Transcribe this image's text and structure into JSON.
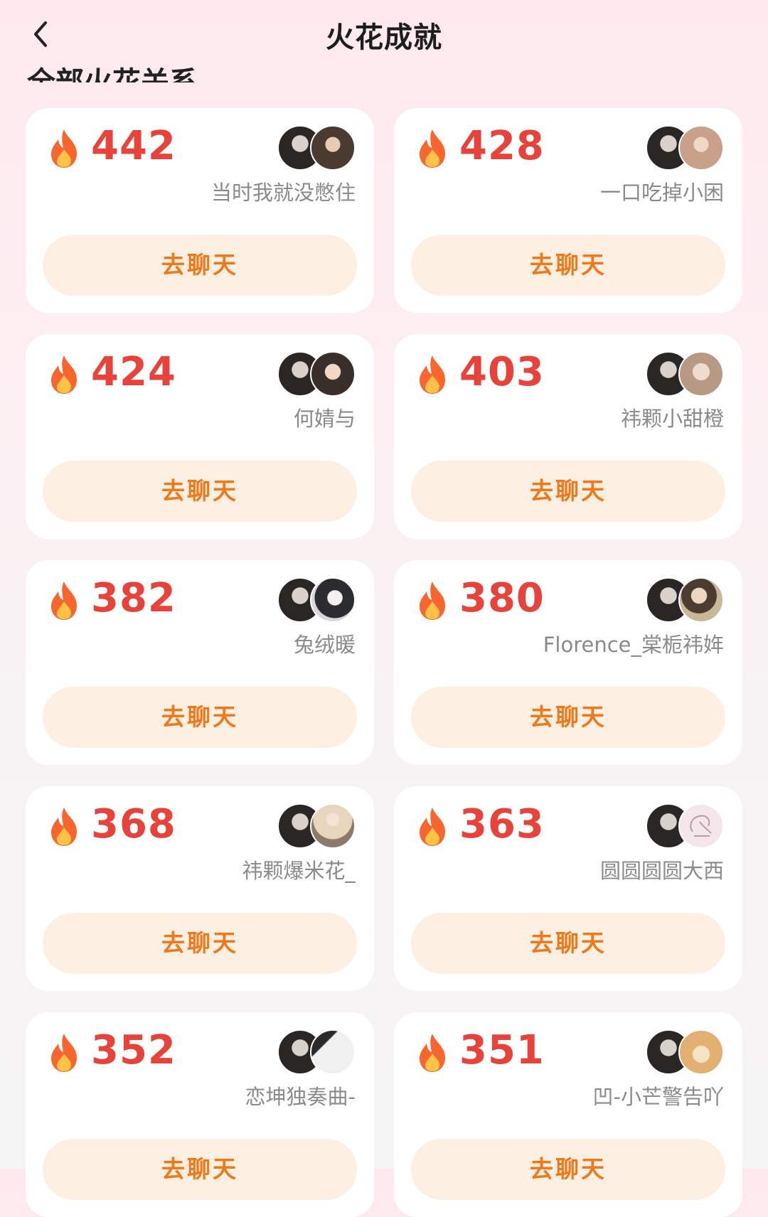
{
  "header": {
    "title": "火花成就",
    "section_heading": "全部火花关系"
  },
  "colors": {
    "count": "#e8433a",
    "button_text": "#f07818",
    "button_bg": "#fdf0e3",
    "flame_outer": "#f8652f",
    "flame_inner": "#ffc247"
  },
  "cards": [
    {
      "count": "442",
      "name": "当时我就没憋住",
      "button": "去聊天",
      "friend_avatar_color": "#4a3a30"
    },
    {
      "count": "428",
      "name": "一口吃掉小困",
      "button": "去聊天",
      "friend_avatar_color": "#c9a08a"
    },
    {
      "count": "424",
      "name": "何婧与",
      "button": "去聊天",
      "friend_avatar_color": "#3a2e2a"
    },
    {
      "count": "403",
      "name": "祎颗小甜橙",
      "button": "去聊天",
      "friend_avatar_color": "#b89a84"
    },
    {
      "count": "382",
      "name": "兔绒暖",
      "button": "去聊天",
      "friend_avatar_color": "#d8d8dc"
    },
    {
      "count": "380",
      "name": "Florence_棠栀祎姩",
      "button": "去聊天",
      "friend_avatar_color": "#c8b89a"
    },
    {
      "count": "368",
      "name": "祎颗爆米花_",
      "button": "去聊天",
      "friend_avatar_color": "#d6c2a4"
    },
    {
      "count": "363",
      "name": "圆圆圆圆大西",
      "button": "去聊天",
      "friend_avatar_color": "#f5e6ec"
    },
    {
      "count": "352",
      "name": "恋坤独奏曲-",
      "button": "去聊天",
      "friend_avatar_color": "#e6e6e6"
    },
    {
      "count": "351",
      "name": "凹-小芒警告吖",
      "button": "去聊天",
      "friend_avatar_color": "#e2b070"
    }
  ]
}
